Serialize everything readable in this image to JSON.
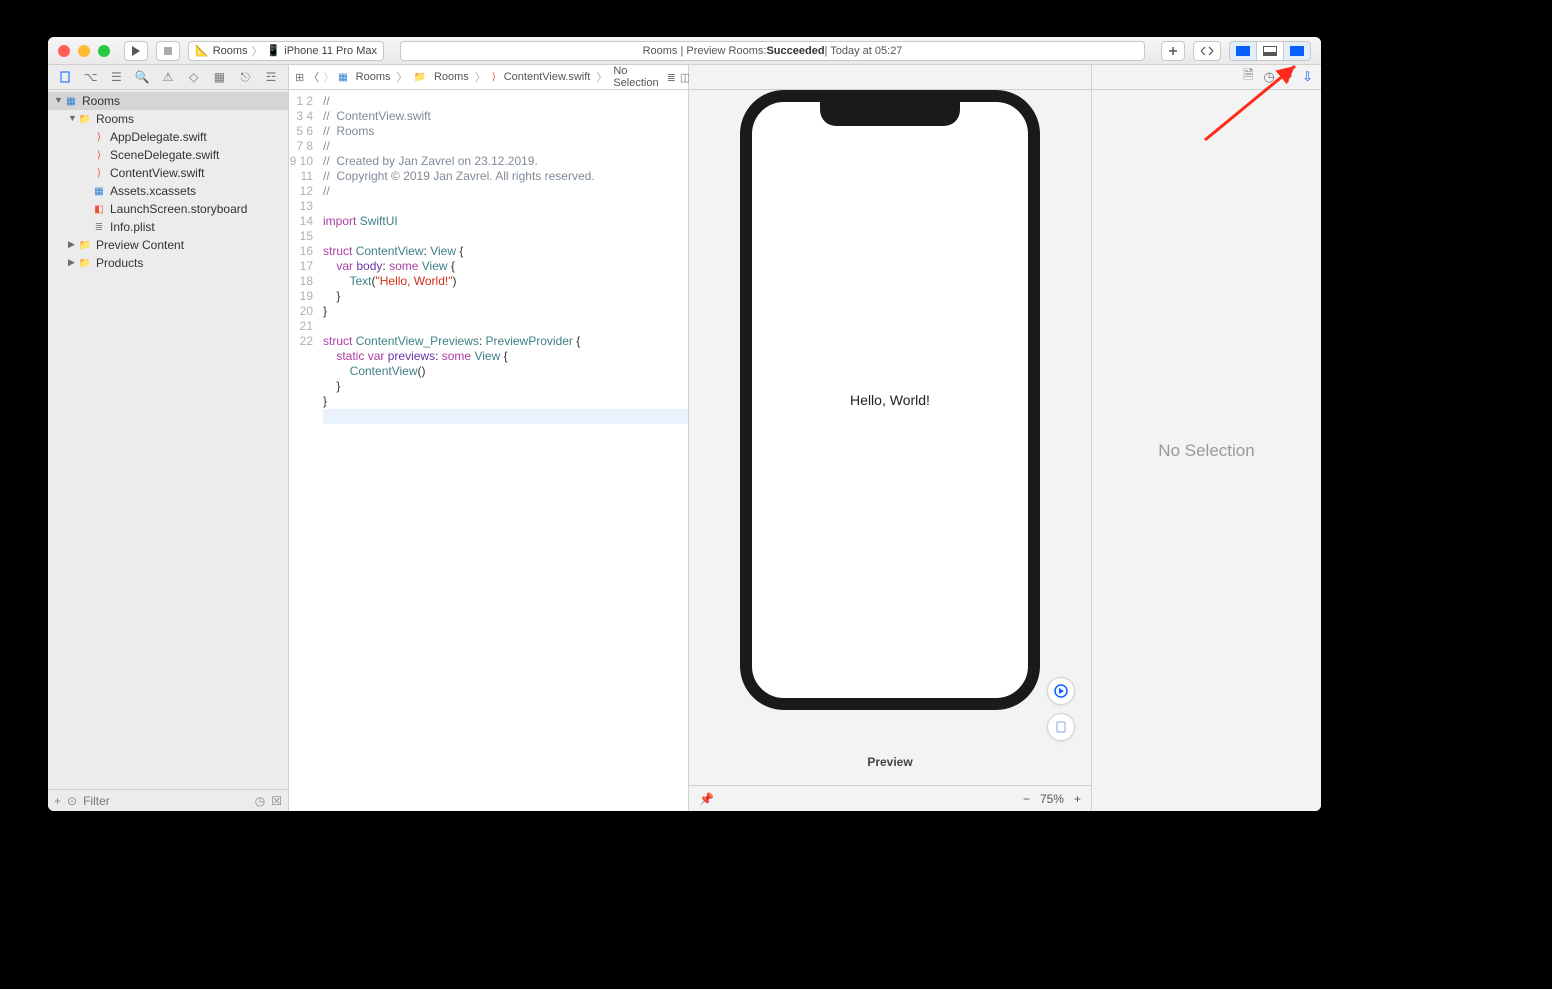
{
  "toolbar": {
    "scheme_project": "Rooms",
    "scheme_device": "iPhone 11 Pro Max",
    "status_prefix": "Rooms | Preview Rooms: ",
    "status_result": "Succeeded",
    "status_suffix": " | Today at 05:27"
  },
  "navigator": {
    "project": "Rooms",
    "group": "Rooms",
    "files": {
      "appdelegate": "AppDelegate.swift",
      "scenedelegate": "SceneDelegate.swift",
      "contentview": "ContentView.swift",
      "assets": "Assets.xcassets",
      "launchscreen": "LaunchScreen.storyboard",
      "infoplist": "Info.plist"
    },
    "preview_content": "Preview Content",
    "products": "Products",
    "filter_placeholder": "Filter"
  },
  "jumpbar": {
    "project": "Rooms",
    "group": "Rooms",
    "file": "ContentView.swift",
    "selection": "No Selection"
  },
  "code": {
    "lines": [
      "//",
      "//  ContentView.swift",
      "//  Rooms",
      "//",
      "//  Created by Jan Zavrel on 23.12.2019.",
      "//  Copyright © 2019 Jan Zavrel. All rights reserved.",
      "//",
      "",
      "import SwiftUI",
      "",
      "struct ContentView: View {",
      "    var body: some View {",
      "        Text(\"Hello, World!\")",
      "    }",
      "}",
      "",
      "struct ContentView_Previews: PreviewProvider {",
      "    static var previews: some View {",
      "        ContentView()",
      "    }",
      "}",
      ""
    ]
  },
  "preview": {
    "text": "Hello, World!",
    "label": "Preview",
    "zoom": "75%"
  },
  "inspector": {
    "empty": "No Selection"
  }
}
